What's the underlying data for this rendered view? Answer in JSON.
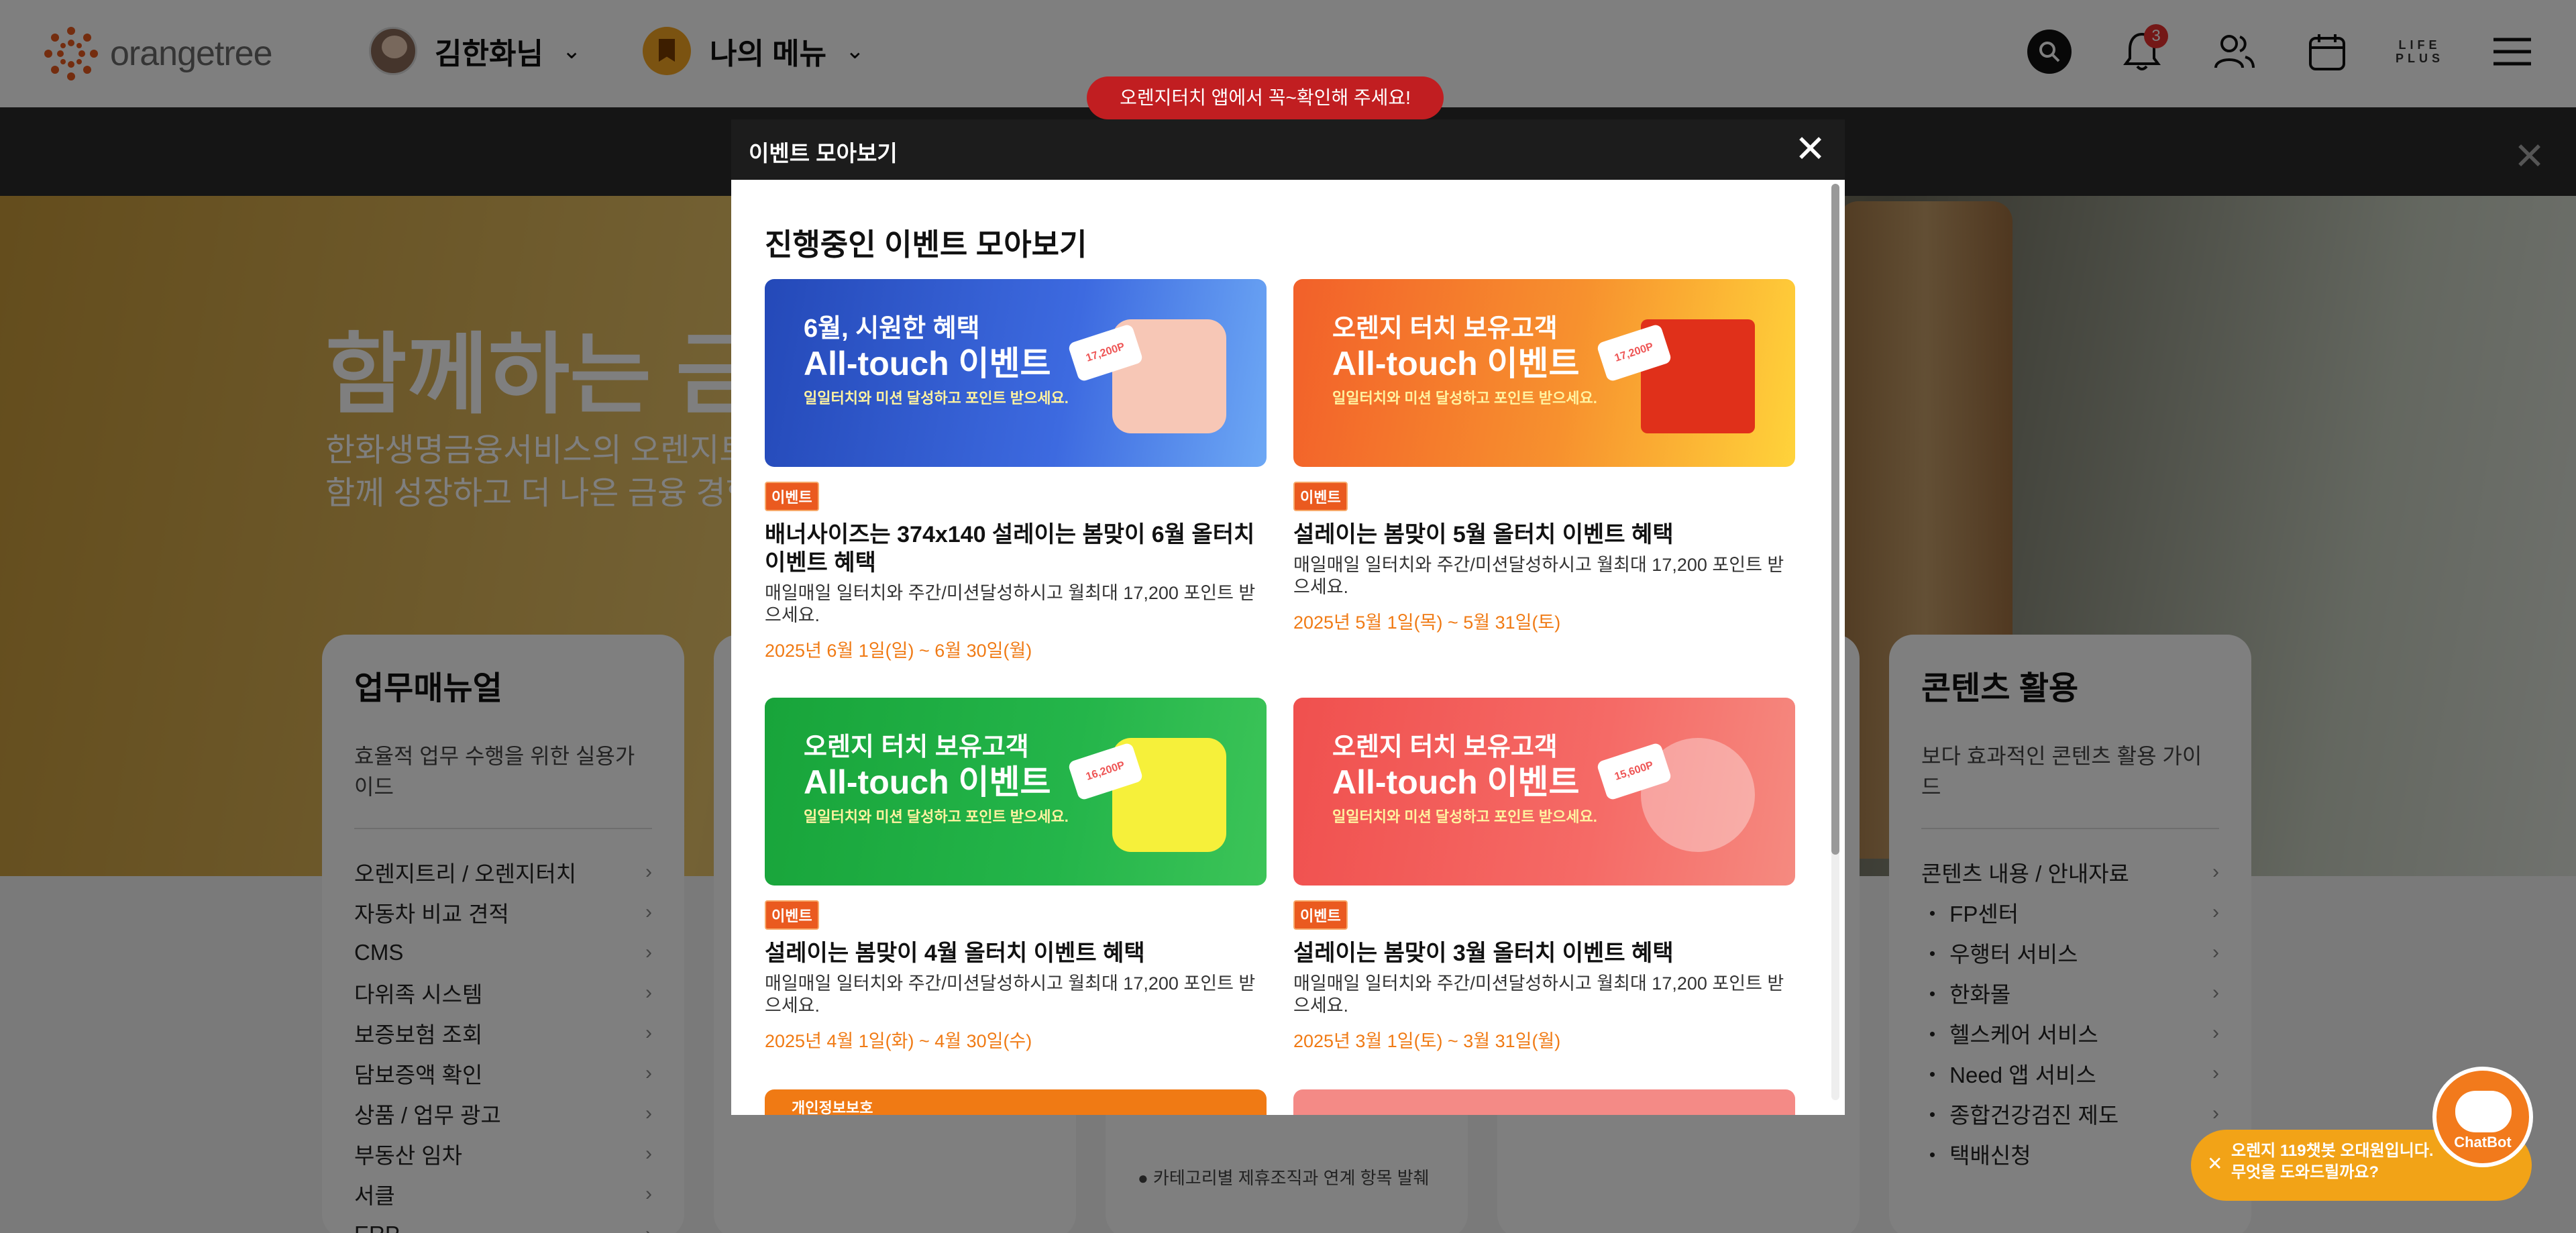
{
  "header": {
    "logo_text": "orangetree",
    "user_name": "김한화님",
    "my_menu": "나의 메뉴",
    "notification_count": "3",
    "lifeplus_line1": "LIFE",
    "lifeplus_line2": "PLUS"
  },
  "notice": "오렌지터치 앱에서 꼭~확인해 주세요!",
  "hero": {
    "title": "함께하는 금융",
    "subtitle_line1": "한화생명금융서비스의 오렌지트리",
    "subtitle_line2": "함께 성장하고 더 나은 금융 경험"
  },
  "cards": {
    "manual": {
      "title": "업무매뉴얼",
      "desc": "효율적 업무 수행을 위한 실용가이드",
      "items": [
        "오렌지트리 / 오렌지터치",
        "자동차 비교 견적",
        "CMS",
        "다위족 시스템",
        "보증보험 조회",
        "담보증액 확인",
        "상품 / 업무 광고",
        "부동산 임차",
        "서클",
        "ERP"
      ]
    },
    "content": {
      "title": "콘텐츠 활용",
      "desc": "보다 효과적인 콘텐츠 활용 가이드",
      "items": [
        "콘텐츠 내용 / 안내자료",
        "・ FP센터",
        "・ 우행터 서비스",
        "・ 한화몰",
        "・ 헬스케어 서비스",
        "・ Need 앱 서비스",
        "・ 종합건강검진 제도",
        "・ 택배신청"
      ]
    },
    "middle_note": "● 카테고리별 제휴조직과 연계 항목 발췌"
  },
  "modal": {
    "title": "이벤트 모아보기",
    "heading": "진행중인 이벤트 모아보기",
    "events": [
      {
        "banner_l1": "6월, 시원한 혜택",
        "banner_l2": "All-touch 이벤트",
        "banner_l3": "일일터치와 미션 달성하고 포인트 받으세요.",
        "coupon": "17,200P",
        "tag": "이벤트",
        "title": "배너사이즈는 374x140 설레이는 봄맞이 6월 올터치 이벤트 혜택",
        "desc": "매일매일 일터치와 주간/미션달성하시고 월최대 17,200 포인트 받으세요.",
        "date": "2025년 6월 1일(일) ~ 6월 30일(월)"
      },
      {
        "banner_l1": "오렌지 터치 보유고객",
        "banner_l2": "All-touch 이벤트",
        "banner_l3": "일일터치와 미션 달성하고 포인트 받으세요.",
        "coupon": "17,200P",
        "tag": "이벤트",
        "title": "설레이는 봄맞이 5월 올터치 이벤트 혜택",
        "desc": "매일매일 일터치와 주간/미션달성하시고 월최대 17,200 포인트 받으세요.",
        "date": "2025년 5월 1일(목) ~ 5월 31일(토)"
      },
      {
        "banner_l1": "오렌지 터치 보유고객",
        "banner_l2": "All-touch 이벤트",
        "banner_l3": "일일터치와 미션 달성하고 포인트 받으세요.",
        "coupon": "16,200P",
        "tag": "이벤트",
        "title": "설레이는 봄맞이 4월 올터치 이벤트 혜택",
        "desc": "매일매일 일터치와 주간/미션달성하시고 월최대 17,200 포인트 받으세요.",
        "date": "2025년 4월 1일(화) ~ 4월 30일(수)"
      },
      {
        "banner_l1": "오렌지 터치 보유고객",
        "banner_l2": "All-touch 이벤트",
        "banner_l3": "일일터치와 미션 달성하고 포인트 받으세요.",
        "coupon": "15,600P",
        "tag": "이벤트",
        "title": "설레이는 봄맞이 3월 올터치 이벤트 혜택",
        "desc": "매일매일 일터치와 주간/미션달성하시고 월최대 17,200 포인트 받으세요.",
        "date": "2025년 3월 1일(토) ~ 3월 31일(월)"
      }
    ],
    "partial_banner_text": "개인정보보호"
  },
  "chatbot": {
    "label": "ChatBot",
    "message_line1": "오렌지 119챗봇 오대원입니다.",
    "message_line2": "무엇을 도와드릴까요?"
  },
  "colors": {
    "brand_orange": "#f07a14",
    "tag_orange": "#ea5a1f",
    "notice_red": "#c11e21",
    "modal_header": "#1c1c1c"
  }
}
